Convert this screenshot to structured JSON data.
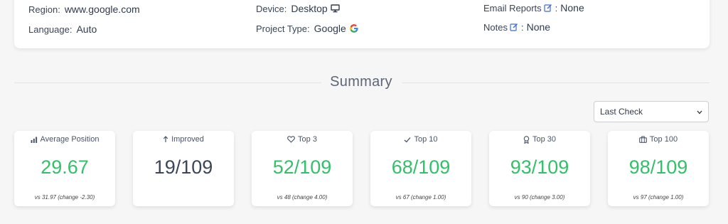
{
  "info": {
    "region": {
      "label": "Region:",
      "value": "www.google.com"
    },
    "language": {
      "label": "Language:",
      "value": "Auto"
    },
    "device": {
      "label": "Device:",
      "value": "Desktop",
      "icon": "desktop-icon"
    },
    "project_type": {
      "label": "Project Type:",
      "value": "Google",
      "icon": "google-logo-icon"
    },
    "email_reports": {
      "label": "Email Reports",
      "value": "None",
      "icon": "edit-icon"
    },
    "notes": {
      "label": "Notes",
      "value": "None",
      "icon": "edit-icon"
    },
    "colon": ":"
  },
  "summary": {
    "title": "Summary",
    "select": {
      "value": "Last Check"
    }
  },
  "stats": [
    {
      "icon": "bar-chart-icon",
      "label": "Average Position",
      "value": "29.67",
      "sub": "vs 31.97 (change -2.30)",
      "color": "#34c06a"
    },
    {
      "icon": "arrow-up-icon",
      "label": "Improved",
      "value": "19/109",
      "sub": "",
      "color": "#3b4657"
    },
    {
      "icon": "heart-icon",
      "label": "Top 3",
      "value": "52/109",
      "sub": "vs 48 (change 4.00)",
      "color": "#34c06a"
    },
    {
      "icon": "check-icon",
      "label": "Top 10",
      "value": "68/109",
      "sub": "vs 67 (change 1.00)",
      "color": "#34c06a"
    },
    {
      "icon": "award-icon",
      "label": "Top 30",
      "value": "93/109",
      "sub": "vs 90 (change 3.00)",
      "color": "#34c06a"
    },
    {
      "icon": "briefcase-icon",
      "label": "Top 100",
      "value": "98/109",
      "sub": "vs 97 (change 1.00)",
      "color": "#34c06a"
    }
  ],
  "colors": {
    "accent_green": "#34c06a",
    "edit_blue": "#3d6bd6"
  }
}
